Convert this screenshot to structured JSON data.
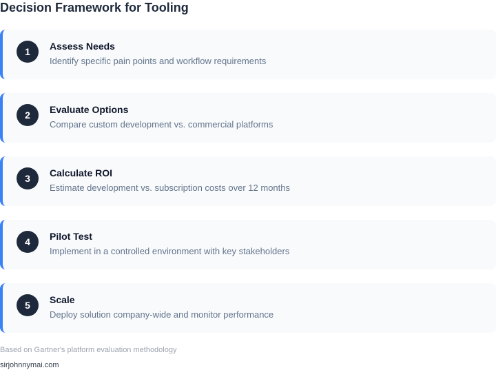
{
  "title": "Decision Framework for Tooling",
  "accent_color": "#3b82f6",
  "steps": [
    {
      "number": "1",
      "title": "Assess Needs",
      "description": "Identify specific pain points and workflow requirements"
    },
    {
      "number": "2",
      "title": "Evaluate Options",
      "description": "Compare custom development vs. commercial platforms"
    },
    {
      "number": "3",
      "title": "Calculate ROI",
      "description": "Estimate development vs. subscription costs over 12 months"
    },
    {
      "number": "4",
      "title": "Pilot Test",
      "description": "Implement in a controlled environment with key stakeholders"
    },
    {
      "number": "5",
      "title": "Scale",
      "description": "Deploy solution company-wide and monitor performance"
    }
  ],
  "source_note": "Based on Gartner's platform evaluation methodology",
  "footer": "sirjohnnymai.com"
}
